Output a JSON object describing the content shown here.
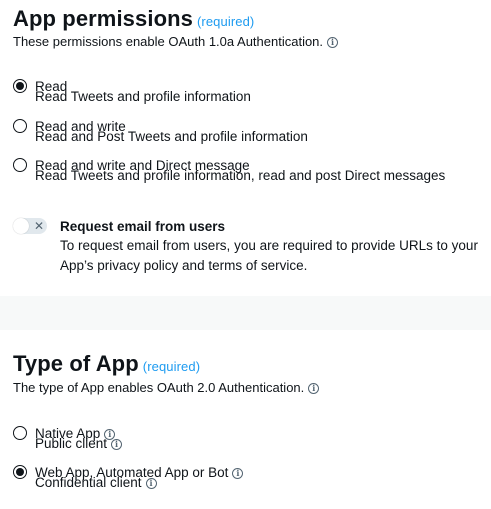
{
  "app_permissions": {
    "title": "App permissions",
    "required": "(required)",
    "description": "These permissions enable OAuth 1.0a Authentication.",
    "options": [
      {
        "label": "Read",
        "sublabel": "Read Tweets and profile information",
        "checked": true
      },
      {
        "label": "Read and write",
        "sublabel": "Read and Post Tweets and profile information",
        "checked": false
      },
      {
        "label": "Read and write and Direct message",
        "sublabel": "Read Tweets and profile information, read and post Direct messages",
        "checked": false
      }
    ],
    "email_toggle": {
      "on": false,
      "title": "Request email from users",
      "description": "To request email from users, you are required to provide URLs to your App’s privacy policy and terms of service."
    }
  },
  "type_of_app": {
    "title": "Type of App",
    "required": "(required)",
    "description": "The type of App enables OAuth 2.0 Authentication.",
    "options": [
      {
        "label": "Native App",
        "sublabel": "Public client",
        "checked": false
      },
      {
        "label": "Web App, Automated App or Bot",
        "sublabel": "Confidential client",
        "checked": true
      }
    ]
  },
  "icons": {
    "info": "info-circle-icon",
    "toggle_off": "x-icon"
  },
  "colors": {
    "accent": "#1d9bf0",
    "text": "#0f1419",
    "page_bg": "#f7f9f9"
  }
}
